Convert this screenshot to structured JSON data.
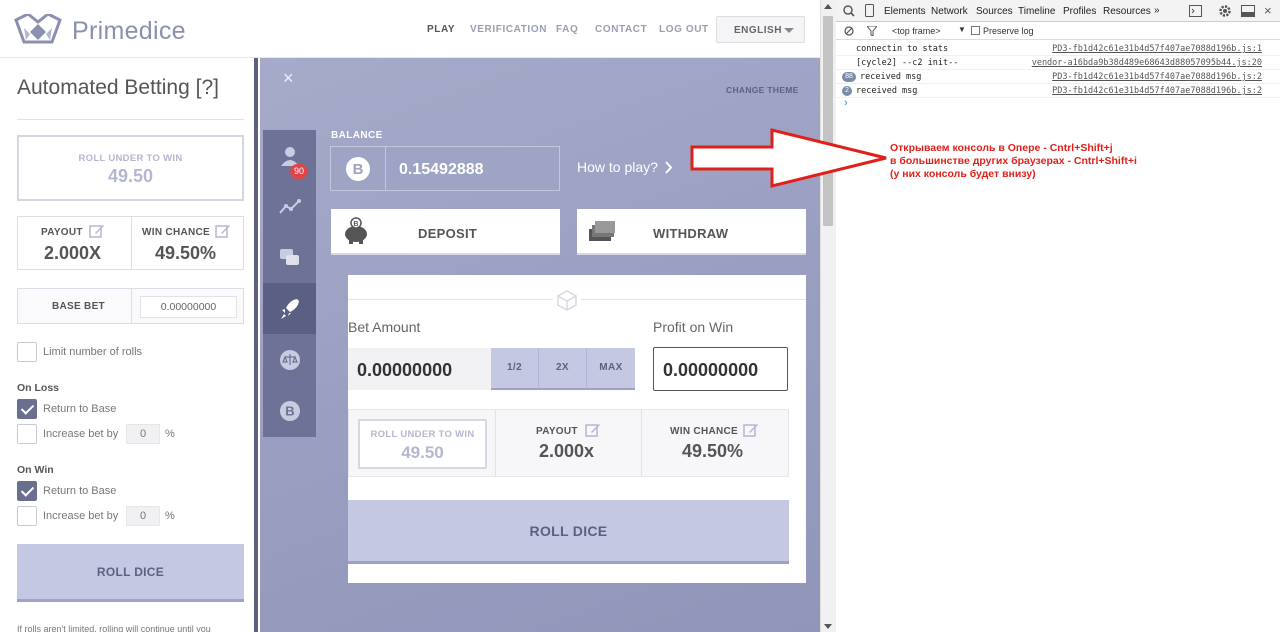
{
  "header": {
    "brand": "Primedice",
    "nav": [
      "PLAY",
      "VERIFICATION",
      "FAQ",
      "CONTACT",
      "LOG OUT"
    ],
    "active_nav": "PLAY",
    "language": "ENGLISH"
  },
  "left": {
    "title": "Automated Betting [?]",
    "roll_under_label": "ROLL UNDER TO WIN",
    "roll_under_value": "49.50",
    "payout_label": "PAYOUT",
    "payout_value": "2.000X",
    "win_chance_label": "WIN CHANCE",
    "win_chance_value": "49.50%",
    "base_bet_label": "BASE BET",
    "base_bet_value": "0.00000000",
    "limit_rolls_label": "Limit number of rolls",
    "limit_rolls_checked": false,
    "on_loss_label": "On Loss",
    "on_loss_return": "Return to Base",
    "on_loss_return_checked": true,
    "on_loss_increase": "Increase bet by",
    "on_loss_increase_value": "0",
    "on_loss_increase_checked": false,
    "on_win_label": "On Win",
    "on_win_return": "Return to Base",
    "on_win_return_checked": true,
    "on_win_increase": "Increase bet by",
    "on_win_increase_value": "0",
    "on_win_increase_checked": false,
    "percent": "%",
    "roll_button": "ROLL DICE",
    "footer_text": "If rolls aren't limited, rolling will continue until you"
  },
  "main": {
    "close": "×",
    "change_theme": "CHANGE THEME",
    "balance_label": "BALANCE",
    "balance_value": "0.15492888",
    "how_to_play": "How to play?",
    "deposit": "DEPOSIT",
    "withdraw": "WITHDRAW",
    "chat_badge": "90",
    "bet_amount_label": "Bet Amount",
    "bet_amount_value": "0.00000000",
    "half": "1/2",
    "double": "2X",
    "max": "MAX",
    "profit_label": "Profit on Win",
    "profit_value": "0.00000000",
    "roll_under_label": "ROLL UNDER TO WIN",
    "roll_under_value": "49.50",
    "payout_label": "PAYOUT",
    "payout_value": "2.000x",
    "win_chance_label": "WIN CHANCE",
    "win_chance_value": "49.50%",
    "roll_button": "ROLL DICE"
  },
  "devtools": {
    "tabs": [
      "Elements",
      "Network",
      "Sources",
      "Timeline",
      "Profiles",
      "Resources",
      "»"
    ],
    "frame": "<top frame>",
    "preserve_log": "Preserve log",
    "logs": [
      {
        "count": "",
        "msg": "connectin to stats",
        "src": "PD3-fb1d42c61e31b4d57f407ae7088d196b.js:1"
      },
      {
        "count": "",
        "msg": "[cycle2] --c2 init--",
        "src": "vendor-a16bda9b38d489e68643d88057095b44.js:20"
      },
      {
        "count": "88",
        "msg": "received msg",
        "src": "PD3-fb1d42c61e31b4d57f407ae7088d196b.js:2"
      },
      {
        "count": "2",
        "msg": "received msg",
        "src": "PD3-fb1d42c61e31b4d57f407ae7088d196b.js:2"
      }
    ],
    "prompt": "›"
  },
  "annotation": {
    "line1": "Открываем консоль в Опере - Cntrl+Shift+j",
    "line2": "в большинстве других браузерах - Cntrl+Shift+i",
    "line3": "(у них консоль будет внизу)",
    "color": "#e0211b"
  }
}
